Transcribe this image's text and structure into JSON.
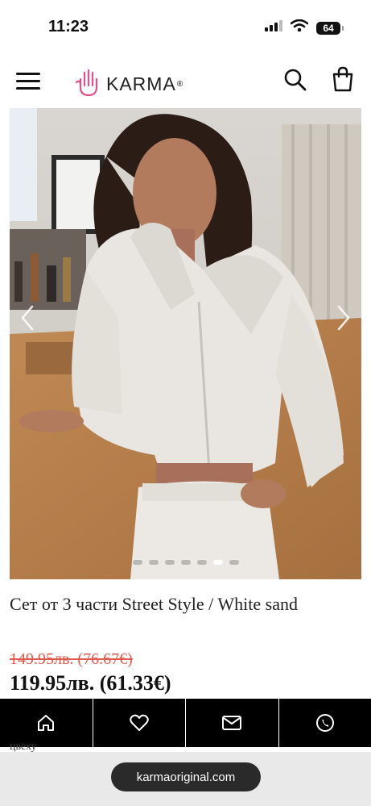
{
  "status_bar": {
    "time": "11:23",
    "battery": "64",
    "icons": [
      "signal-icon",
      "wifi-icon",
      "battery-icon"
    ]
  },
  "header": {
    "brand": "KARMA",
    "brand_mark": "®",
    "icons": [
      "menu-icon",
      "logo-hand-icon",
      "search-icon",
      "shopping-bag-icon"
    ],
    "brand_color": "#e6508a"
  },
  "gallery": {
    "slide_count": 7,
    "active_index": 5,
    "icons": [
      "chevron-left-icon",
      "chevron-right-icon"
    ]
  },
  "product": {
    "title": "Сет от 3 части Street Style / White sand",
    "old_price": "149.95лв. (76.67€)",
    "new_price": "119.95лв. (61.33€)",
    "old_price_color": "#e05a4d"
  },
  "bottom_nav": {
    "items": [
      "home-icon",
      "heart-icon",
      "mail-icon",
      "phone-icon"
    ]
  },
  "peek": {
    "text": "цвеху"
  },
  "browser": {
    "url": "karmaoriginal.com"
  }
}
